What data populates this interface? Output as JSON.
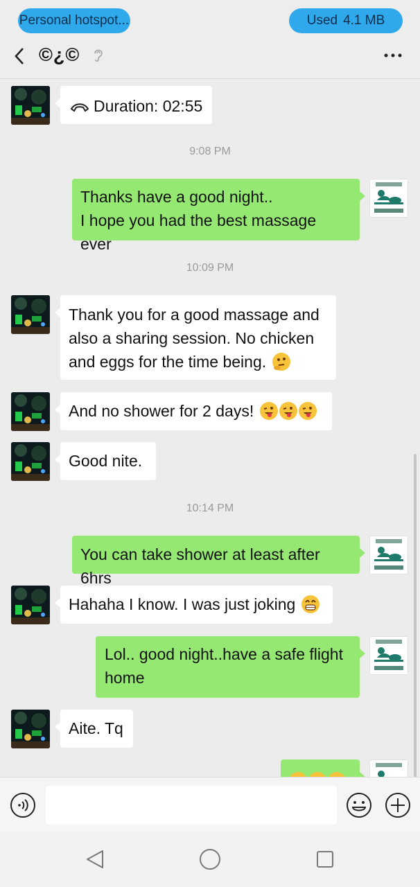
{
  "status_bar": {
    "hotspot_label": "Personal hotspot...",
    "data_used_label": "Used",
    "data_used_value": "4.1 MB"
  },
  "header": {
    "title": "©¿©",
    "back_icon": "chevron-left-icon",
    "ear_icon": "ear-icon",
    "more_icon": "more-dots-icon"
  },
  "messages": [
    {
      "type": "call",
      "sender": "them",
      "text": "Duration: 02:55",
      "icon": "phone-hangup-icon"
    },
    {
      "type": "time",
      "text": "9:08 PM"
    },
    {
      "type": "text",
      "sender": "me",
      "lines": [
        "Thanks have a good night..",
        "I hope you had the best massage ever"
      ]
    },
    {
      "type": "time",
      "text": "10:09 PM"
    },
    {
      "type": "text",
      "sender": "them",
      "lines": [
        "Thank you for a good massage and",
        "also a sharing session. No chicken",
        "and eggs for the time being."
      ],
      "emoji": [
        "thinking-face"
      ]
    },
    {
      "type": "text",
      "sender": "them",
      "lines": [
        "And no shower for 2 days!"
      ],
      "emoji": [
        "winking-tongue",
        "winking-tongue",
        "winking-tongue"
      ]
    },
    {
      "type": "text",
      "sender": "them",
      "lines": [
        "Good nite."
      ]
    },
    {
      "type": "time",
      "text": "10:14 PM"
    },
    {
      "type": "text",
      "sender": "me",
      "lines": [
        "You can take shower at least after 6hrs"
      ]
    },
    {
      "type": "text",
      "sender": "them",
      "lines": [
        "Hahaha I know. I was just joking"
      ],
      "emoji": [
        "grinning-teeth"
      ]
    },
    {
      "type": "text",
      "sender": "me",
      "lines": [
        "Lol.. good night..have a safe flight",
        "home"
      ]
    },
    {
      "type": "text",
      "sender": "them",
      "lines": [
        "Aite. Tq"
      ]
    },
    {
      "type": "emoji-only",
      "sender": "me",
      "emoji": [
        "grinning",
        "grinning",
        "grinning"
      ]
    }
  ],
  "input_bar": {
    "voice_icon": "voice-icon",
    "emoji_icon": "smiley-icon",
    "plus_icon": "plus-icon",
    "input_value": ""
  },
  "nav_bar": {
    "back_icon": "nav-back-triangle-icon",
    "home_icon": "nav-home-circle-icon",
    "recent_icon": "nav-recent-square-icon"
  },
  "colors": {
    "status_pill": "#2fa9ec",
    "my_bubble": "#95e872",
    "their_bubble": "#ffffff",
    "background": "#ececec"
  }
}
